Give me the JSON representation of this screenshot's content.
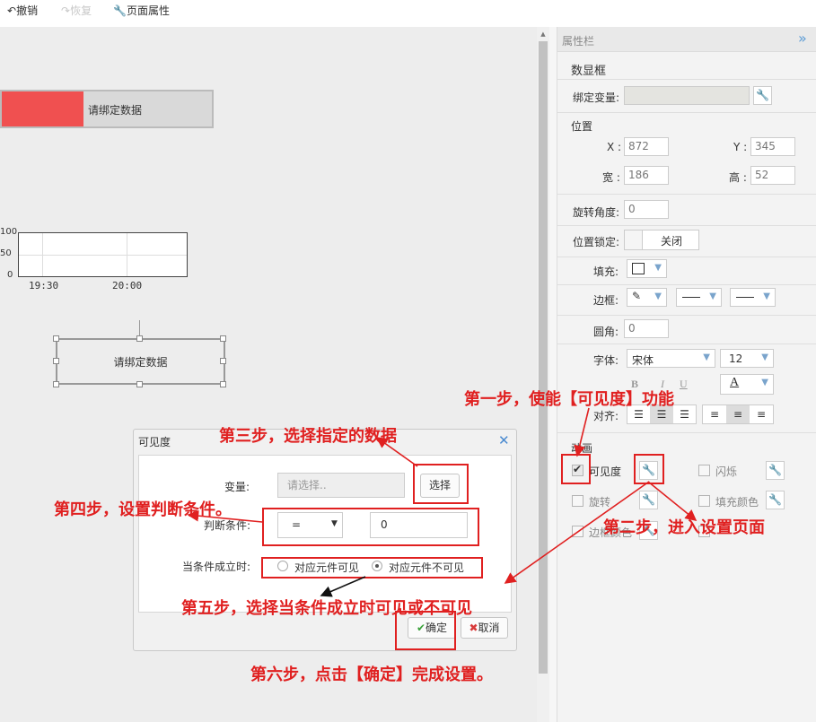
{
  "toolbar": {
    "undo_label": "撤销",
    "redo_label": "恢复",
    "page_props_label": "页面属性"
  },
  "canvas": {
    "bar_widget_text": "请绑定数据",
    "bar_fill_fraction": 0.39,
    "bar_fill_color": "#f05050",
    "chart_yticks": [
      "100",
      "50",
      "0"
    ],
    "chart_xticks": [
      "19:30",
      "20:00"
    ],
    "selected_widget_text": "请绑定数据"
  },
  "panel": {
    "title": "属性栏",
    "collapse_icon": "double-chevron-right",
    "widget_type": "数显框",
    "bind_var_label": "绑定变量:",
    "position_label": "位置",
    "x_label": "X :",
    "x_value": "872",
    "y_label": "Y :",
    "y_value": "345",
    "w_label": "宽 :",
    "w_value": "186",
    "h_label": "高 :",
    "h_value": "52",
    "rotation_label": "旋转角度:",
    "rotation_value": "0",
    "lock_label": "位置锁定:",
    "lock_value": "关闭",
    "fill_label": "填充:",
    "border_label": "边框:",
    "radius_label": "圆角:",
    "radius_value": "0",
    "font_label": "字体:",
    "font_value": "宋体",
    "font_size": "12",
    "bold": "B",
    "italic": "I",
    "underline": "U",
    "color_glyph": "A",
    "align_label": "对齐:",
    "anim_label": "动画",
    "visibility_label": "可见度",
    "blink_label": "闪烁",
    "rotate_label": "旋转",
    "fill_color_label": "填充颜色",
    "border_color_label": "边框颜色"
  },
  "dialog": {
    "title": "可见度",
    "var_label": "变量:",
    "var_placeholder": "请选择..",
    "select_button": "选择",
    "condition_label": "判断条件:",
    "operator": "=",
    "condition_value": "0",
    "when_true_label": "当条件成立时:",
    "option_visible": "对应元件可见",
    "option_invisible": "对应元件不可见",
    "selected_option": "option_invisible",
    "confirm": "确定",
    "cancel": "取消"
  },
  "annotations": {
    "step1": "第一步，使能【可见度】功能",
    "step2": "第二步，进入设置页面",
    "step3": "第三步，选择指定的数据",
    "step4": "第四步，设置判断条件。",
    "step5": "第五步，选择当条件成立时可见或不可见",
    "step6": "第六步，点击【确定】完成设置。"
  },
  "colors": {
    "annotation": "#e02020",
    "accent": "#7aa4cc",
    "bar_fill": "#f05050"
  }
}
